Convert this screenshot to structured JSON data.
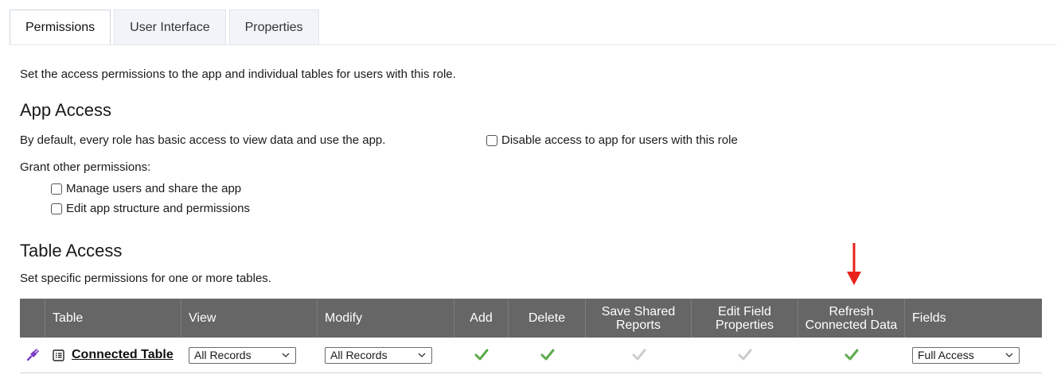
{
  "tabs": [
    {
      "label": "Permissions",
      "active": true
    },
    {
      "label": "User Interface",
      "active": false
    },
    {
      "label": "Properties",
      "active": false
    }
  ],
  "intro": "Set the access permissions to the app and individual tables for users with this role.",
  "app_access": {
    "heading": "App Access",
    "default_text": "By default, every role has basic access to view data and use the app.",
    "disable_label": "Disable access to app for users with this role",
    "grant_label": "Grant other permissions:",
    "permissions": [
      {
        "label": "Manage users and share the app",
        "checked": false
      },
      {
        "label": "Edit app structure and permissions",
        "checked": false
      }
    ]
  },
  "table_access": {
    "heading": "Table Access",
    "subtitle": "Set specific permissions for one or more tables.",
    "columns": {
      "table": "Table",
      "view": "View",
      "modify": "Modify",
      "add": "Add",
      "delete": "Delete",
      "save_shared_line1": "Save Shared",
      "save_shared_line2": "Reports",
      "edit_field_line1": "Edit Field",
      "edit_field_line2": "Properties",
      "refresh_line1": "Refresh",
      "refresh_line2": "Connected Data",
      "fields": "Fields"
    },
    "rows": [
      {
        "name": "Connected Table",
        "view": "All Records",
        "modify": "All Records",
        "fields": "Full Access",
        "add": true,
        "delete": true,
        "save_shared_reports": false,
        "edit_field_properties": false,
        "refresh_connected_data": true
      }
    ]
  },
  "colors": {
    "header_bg": "#666666",
    "check_on": "#5aab4c",
    "check_off": "#cccccc",
    "arrow": "#e8231b",
    "connector_icon": "#7b3fc4"
  }
}
